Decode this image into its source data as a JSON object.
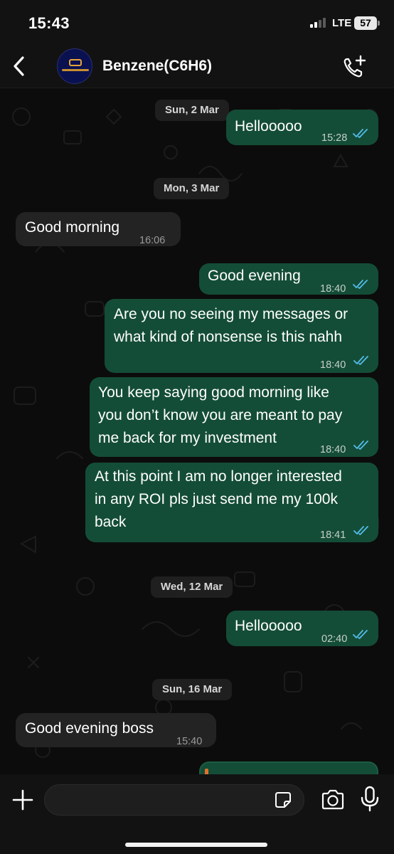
{
  "status_bar": {
    "time": "15:43",
    "network": "LTE",
    "battery": "57"
  },
  "header": {
    "contact_name": "Benzene(C6H6)",
    "back_icon": "chevron-left-icon",
    "call_icon": "add-call-icon"
  },
  "date_dividers": [
    "Sun, 2 Mar",
    "Mon, 3 Mar",
    "Wed, 12 Mar",
    "Sun, 16 Mar"
  ],
  "messages": [
    {
      "direction": "outgoing",
      "text": "Hellooooo",
      "time": "15:28",
      "status": "read"
    },
    {
      "direction": "incoming",
      "text": "Good morning",
      "time": "16:06"
    },
    {
      "direction": "outgoing",
      "text": "Good evening",
      "time": "18:40",
      "status": "read"
    },
    {
      "direction": "outgoing",
      "lines": [
        "Are you no seeing my messages or",
        "what kind of nonsense is this nahh"
      ],
      "time": "18:40",
      "status": "read"
    },
    {
      "direction": "outgoing",
      "lines": [
        "You keep saying good morning like",
        "you don’t know you are meant to pay",
        "me back for my investment"
      ],
      "time": "18:40",
      "status": "read"
    },
    {
      "direction": "outgoing",
      "lines": [
        "At this point I am no longer interested",
        "in any ROI pls just send me my 100k",
        "back"
      ],
      "time": "18:41",
      "status": "read"
    },
    {
      "direction": "outgoing",
      "text": "Hellooooo",
      "time": "02:40",
      "status": "read"
    },
    {
      "direction": "incoming",
      "text": "Good evening boss",
      "time": "15:40"
    }
  ],
  "composer": {
    "placeholder": "",
    "value": ""
  },
  "colors": {
    "outgoing_bubble": "#144d37",
    "incoming_bubble": "#232323",
    "read_ticks": "#53bdeb",
    "background": "#0c0c0c"
  }
}
